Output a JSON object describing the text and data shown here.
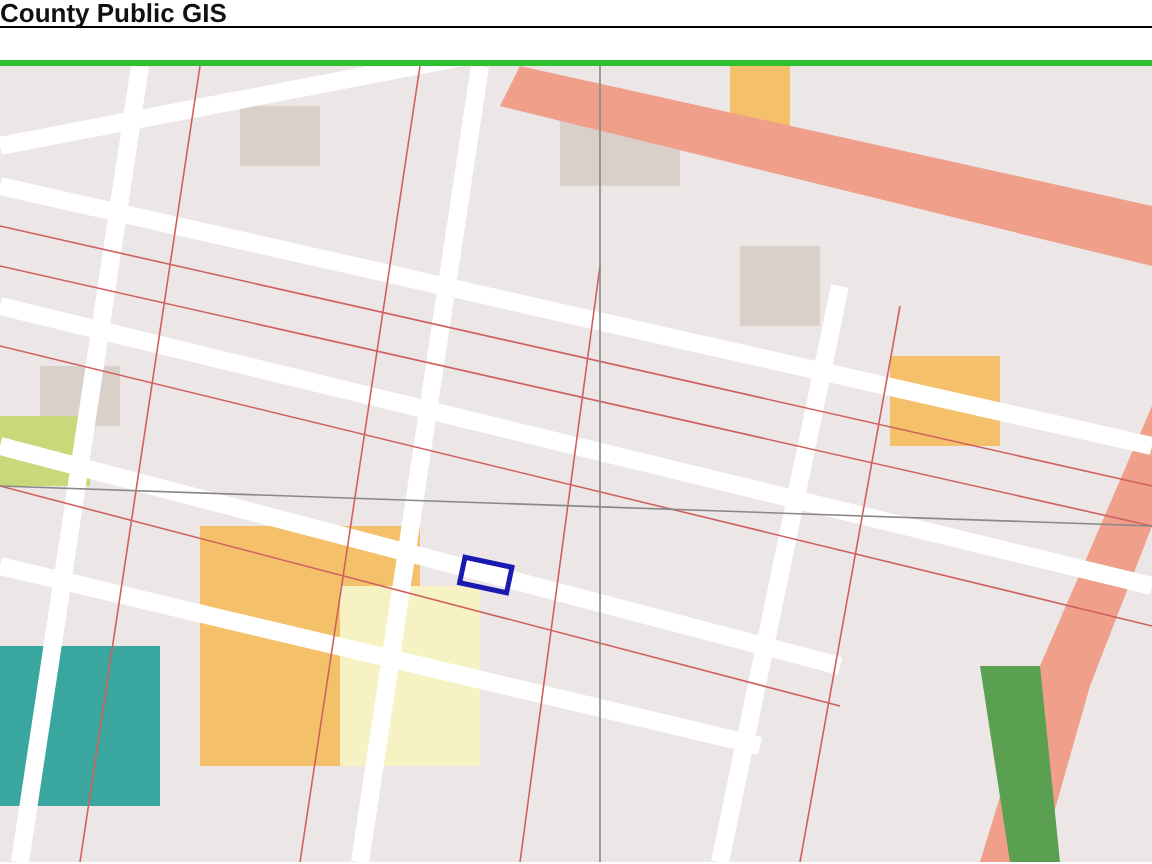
{
  "header": {
    "title": "County Public GIS"
  }
}
